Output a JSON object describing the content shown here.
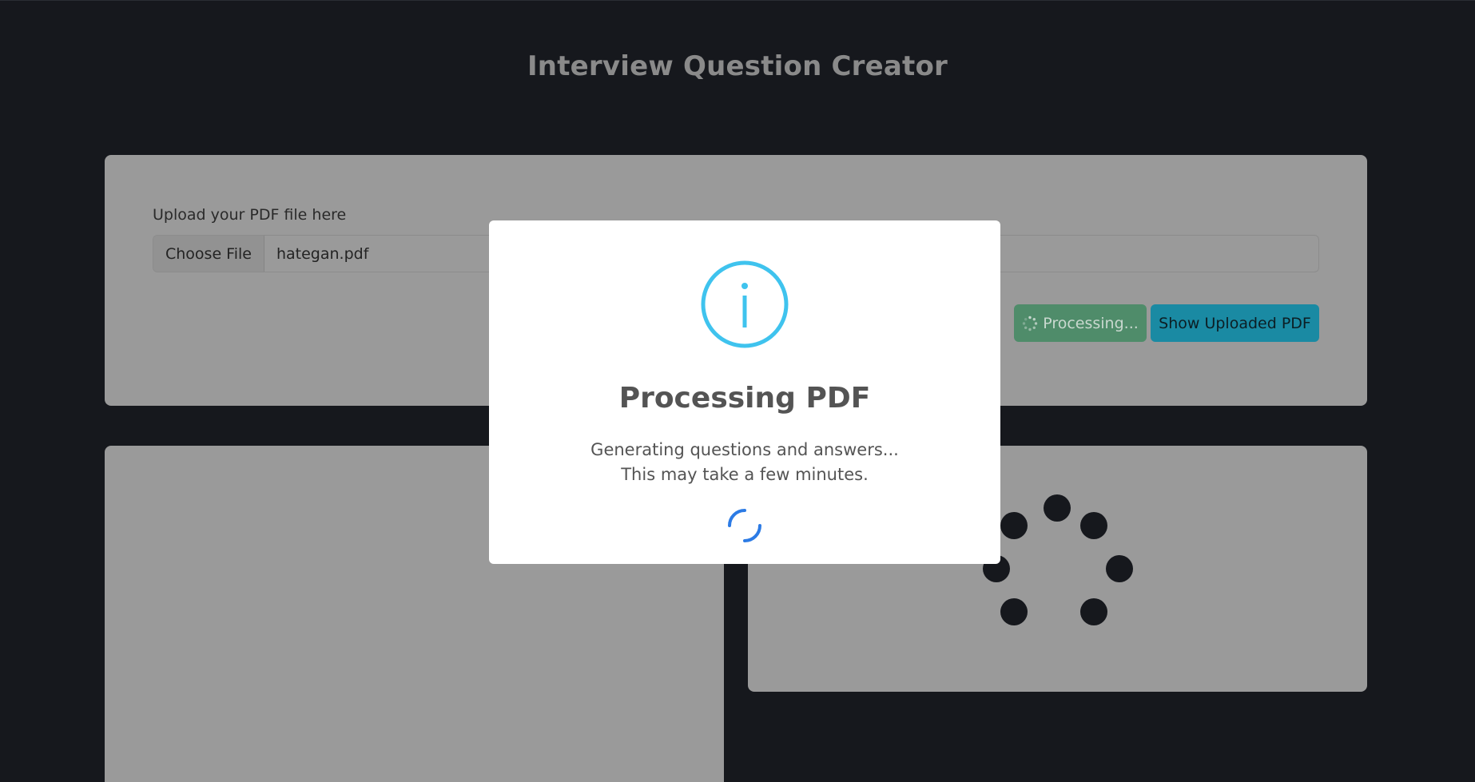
{
  "header": {
    "title": "Interview Question Creator"
  },
  "upload": {
    "label": "Upload your PDF file here",
    "choose_file_label": "Choose File",
    "file_name": "hategan.pdf",
    "processing_button_label": "Processing...",
    "show_pdf_button_label": "Show Uploaded PDF"
  },
  "modal": {
    "icon": "info-icon",
    "title": "Processing PDF",
    "line1": "Generating questions and answers...",
    "line2": "This may take a few minutes."
  },
  "colors": {
    "background": "#16181d",
    "overlay_card": "#9a9a9a",
    "processing_button": "#4f8c6a",
    "show_button": "#1a8aa3",
    "info_accent": "#3fc3ee",
    "loader_accent": "#2c7be5"
  }
}
